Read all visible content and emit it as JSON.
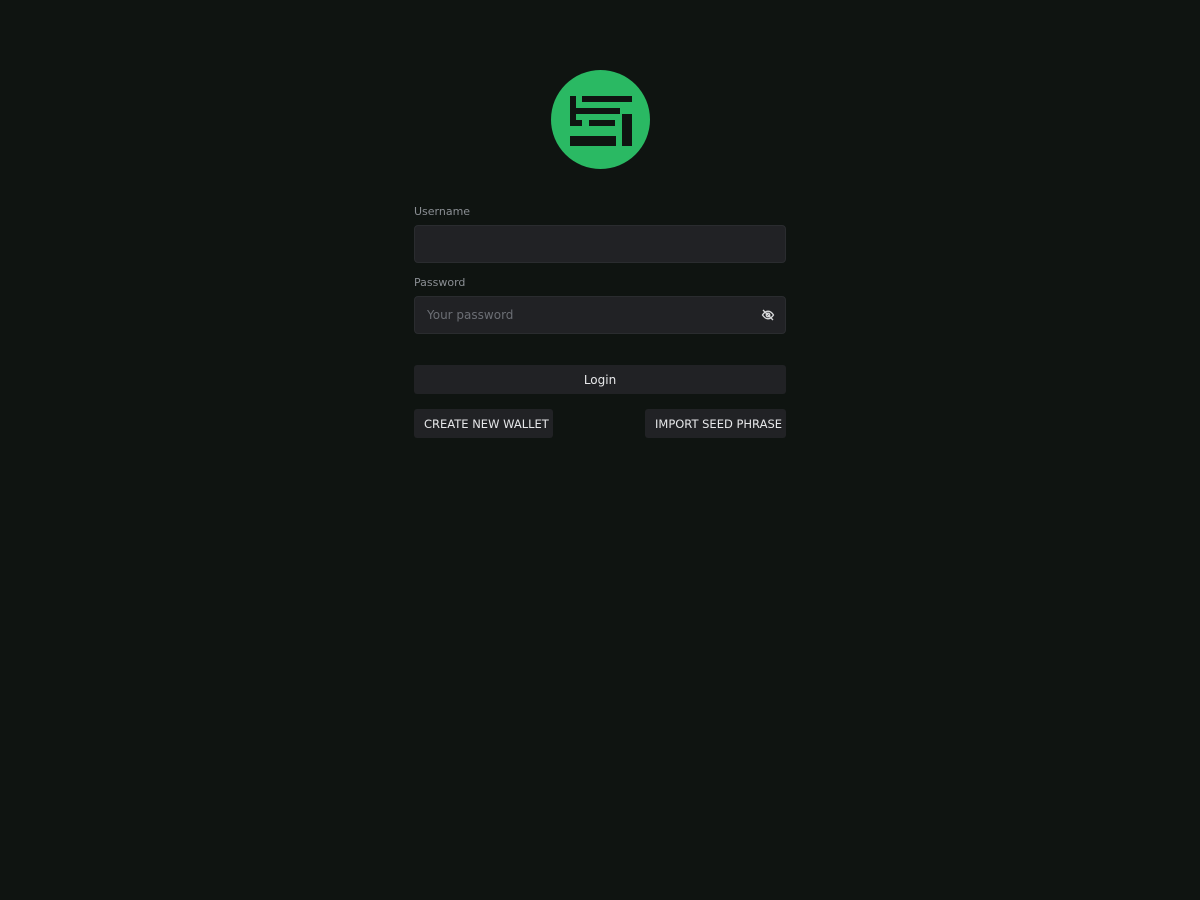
{
  "form": {
    "username_label": "Username",
    "username_value": "",
    "username_placeholder": "",
    "password_label": "Password",
    "password_value": "",
    "password_placeholder": "Your password",
    "login_label": "Login"
  },
  "actions": {
    "create_wallet_label": "CREATE NEW WALLET",
    "import_seed_label": "IMPORT SEED PHRASE"
  },
  "icons": {
    "logo": "app-logo-icon",
    "password_toggle": "eye-off-icon"
  },
  "colors": {
    "background": "#0f1411",
    "brand_green": "#2ab963",
    "input_bg": "#212225"
  }
}
